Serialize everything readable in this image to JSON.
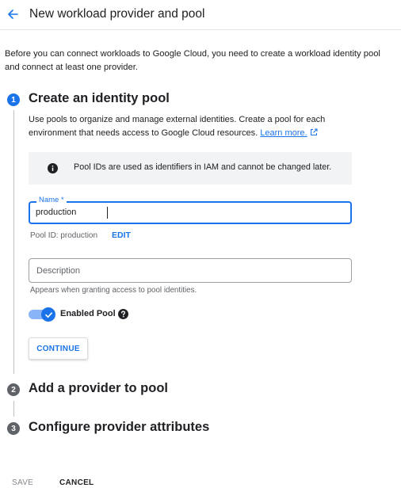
{
  "header": {
    "back_icon": "arrow-left-icon",
    "title": "New workload provider and pool"
  },
  "intro": "Before you can connect workloads to Google Cloud, you need to create a workload identity pool and connect at least one provider.",
  "steps": [
    {
      "number": "1",
      "title": "Create an identity pool",
      "status": "active",
      "description": "Use pools to organize and manage external identities. Create a pool for each environment that needs access to Google Cloud resources.",
      "learn_more": "Learn more.",
      "info": {
        "icon": "info-icon",
        "text": "Pool IDs are used as identifiers in IAM and cannot be changed later."
      },
      "name_field": {
        "label": "Name *",
        "value": "production"
      },
      "pool_id": "Pool ID: production",
      "edit_label": "EDIT",
      "description_field": {
        "placeholder": "Description",
        "value": "",
        "hint": "Appears when granting access to pool identities."
      },
      "toggle": {
        "label": "Enabled Pool",
        "checked": true,
        "help_icon": "help-icon"
      },
      "continue_label": "CONTINUE"
    },
    {
      "number": "2",
      "title": "Add a provider to pool",
      "status": "inactive"
    },
    {
      "number": "3",
      "title": "Configure provider attributes",
      "status": "inactive"
    }
  ],
  "footer": {
    "save_label": "SAVE",
    "save_disabled": true,
    "cancel_label": "CANCEL"
  },
  "colors": {
    "primary": "#1a73e8",
    "toggle_track": "#8ab4f8",
    "step_inactive": "#5f6368",
    "info_bg": "#f1f3f4",
    "text": "#202124",
    "secondary_text": "#5f6368"
  }
}
